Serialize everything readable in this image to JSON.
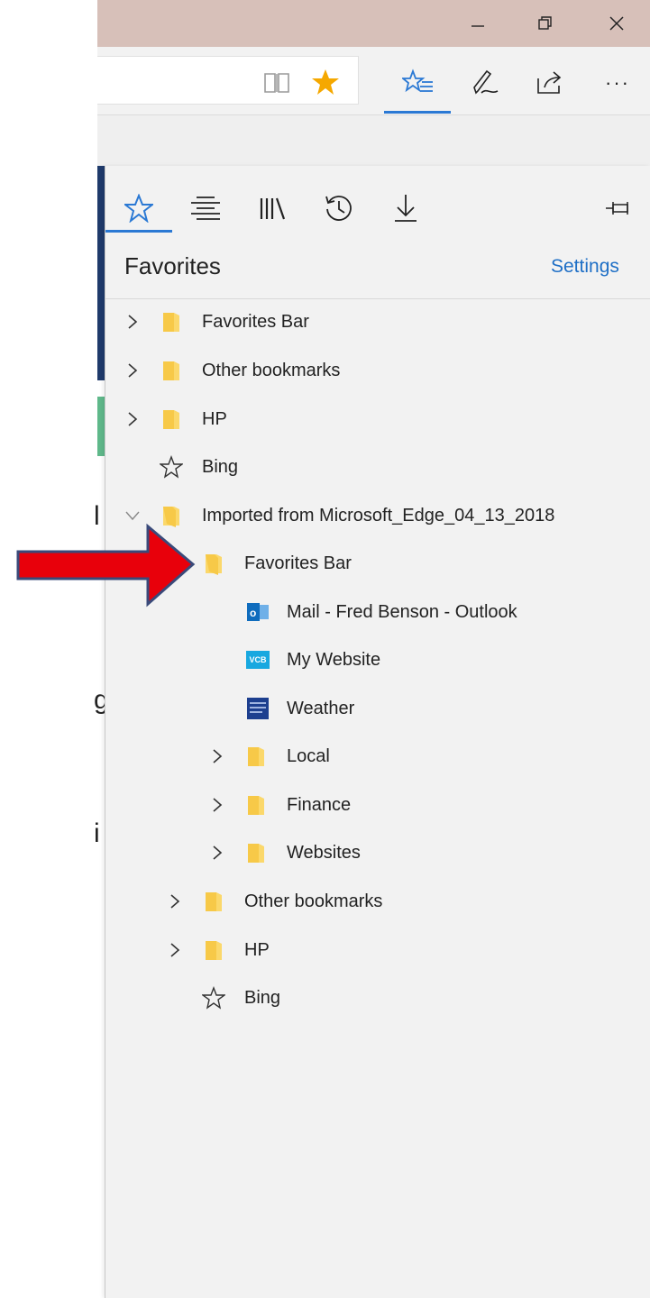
{
  "window": {
    "controls": [
      "minimize",
      "restore",
      "close"
    ]
  },
  "toolbar": {
    "icons": [
      "reading-view-icon",
      "add-favorite-star-icon",
      "hub-favorites-icon",
      "web-note-icon",
      "share-icon",
      "more-icon"
    ],
    "more_label": "···",
    "accent_color": "#2b79d4",
    "star_color": "#f5a800"
  },
  "hub": {
    "tabs": [
      "favorites",
      "reading-list",
      "books",
      "history",
      "downloads"
    ],
    "pin_label": "pin",
    "title": "Favorites",
    "settings_label": "Settings"
  },
  "favorites": {
    "items": [
      {
        "label": "Favorites Bar",
        "type": "folder",
        "expanded": false
      },
      {
        "label": "Other bookmarks",
        "type": "folder",
        "expanded": false
      },
      {
        "label": "HP",
        "type": "folder",
        "expanded": false
      },
      {
        "label": "Bing",
        "type": "favorite"
      },
      {
        "label": "Imported from Microsoft_Edge_04_13_2018",
        "type": "folder",
        "expanded": true,
        "children": [
          {
            "label": "Favorites Bar",
            "type": "folder",
            "expanded": true,
            "children": [
              {
                "label": "Mail - Fred Benson - Outlook",
                "type": "site",
                "icon": "outlook-icon"
              },
              {
                "label": "My Website",
                "type": "site",
                "icon": "vcb-icon",
                "icon_text": "VCB"
              },
              {
                "label": "Weather",
                "type": "site",
                "icon": "weather-channel-icon"
              },
              {
                "label": "Local",
                "type": "folder",
                "expanded": false
              },
              {
                "label": "Finance",
                "type": "folder",
                "expanded": false
              },
              {
                "label": "Websites",
                "type": "folder",
                "expanded": false
              }
            ]
          },
          {
            "label": "Other bookmarks",
            "type": "folder",
            "expanded": false
          },
          {
            "label": "HP",
            "type": "folder",
            "expanded": false
          },
          {
            "label": "Bing",
            "type": "favorite"
          }
        ]
      }
    ]
  },
  "annotation": {
    "arrow_color": "#e8000b",
    "arrow_outline": "#3a4a7a"
  },
  "page_fragments": [
    "l",
    "g",
    "i"
  ]
}
